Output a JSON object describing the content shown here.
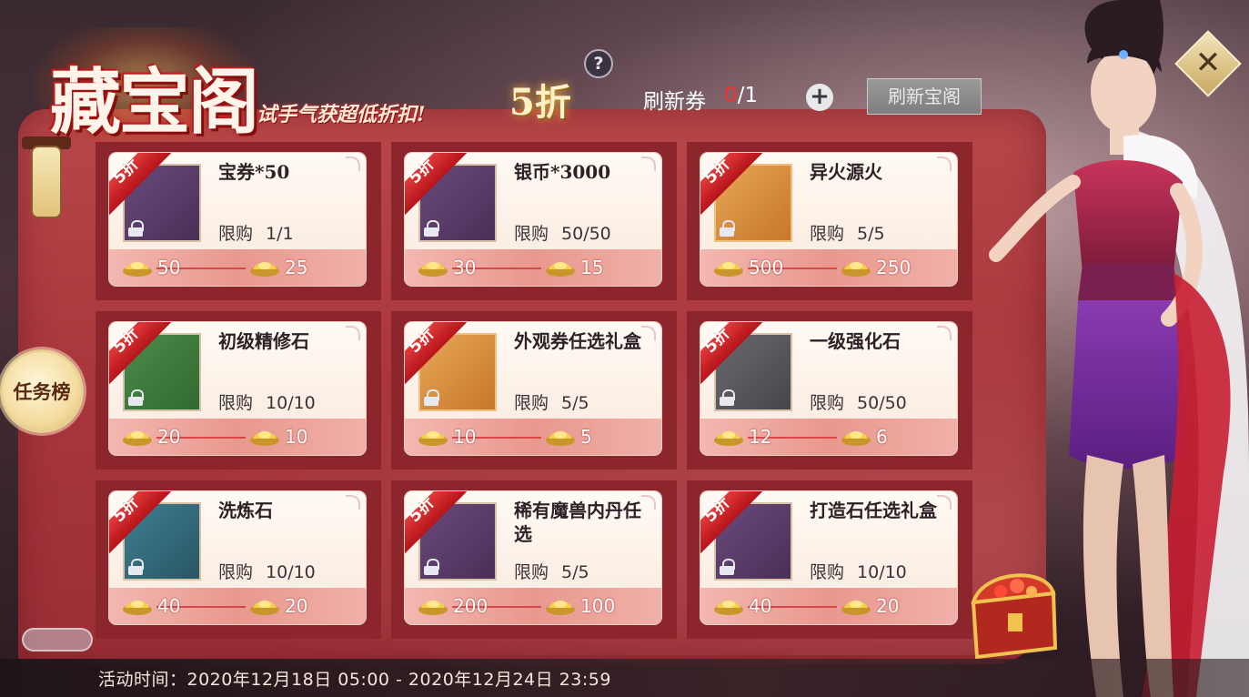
{
  "header": {
    "title": "藏宝阁",
    "subtitle": "试手气获超低折扣!",
    "discount": "5折",
    "help": "?",
    "refresh_label": "刷新券",
    "refresh_current": "0",
    "refresh_total": "/1",
    "plus": "+",
    "refresh_shop_button": "刷新宝阁",
    "close": "✕"
  },
  "side": {
    "task_button": "任务榜"
  },
  "footer": {
    "event_time": "活动时间：2020年12月18日 05:00 - 2020年12月24日 23:59"
  },
  "colors": {
    "panel": "#a8363c",
    "ribbon": "#d42a2a",
    "price_bar": "#e9988e",
    "refresh_current": "#ff2a2a"
  },
  "items": [
    {
      "name": "宝券*50",
      "ribbon": "5折",
      "limit_label": "限购",
      "limit": "1/1",
      "old_price": "50",
      "new_price": "25",
      "icon": "treasure-coupon-icon",
      "tone": "purple"
    },
    {
      "name": "银币*3000",
      "ribbon": "5折",
      "limit_label": "限购",
      "limit": "50/50",
      "old_price": "30",
      "new_price": "15",
      "icon": "silver-coin-icon",
      "tone": "purple"
    },
    {
      "name": "异火源火",
      "ribbon": "5折",
      "limit_label": "限购",
      "limit": "5/5",
      "old_price": "500",
      "new_price": "250",
      "icon": "flame-icon",
      "tone": "orange"
    },
    {
      "name": "初级精修石",
      "ribbon": "5折",
      "limit_label": "限购",
      "limit": "10/10",
      "old_price": "20",
      "new_price": "10",
      "icon": "crystal-icon",
      "tone": "green"
    },
    {
      "name": "外观券任选礼盒",
      "ribbon": "5折",
      "limit_label": "限购",
      "limit": "5/5",
      "old_price": "10",
      "new_price": "5",
      "icon": "gift-box-icon",
      "tone": "orange"
    },
    {
      "name": "一级强化石",
      "ribbon": "5折",
      "limit_label": "限购",
      "limit": "50/50",
      "old_price": "12",
      "new_price": "6",
      "icon": "ore-stone-icon",
      "tone": "grey"
    },
    {
      "name": "洗炼石",
      "ribbon": "5折",
      "limit_label": "限购",
      "limit": "10/10",
      "old_price": "40",
      "new_price": "20",
      "icon": "blue-gem-icon",
      "tone": "blue"
    },
    {
      "name": "稀有魔兽内丹任选",
      "ribbon": "5折",
      "limit_label": "限购",
      "limit": "5/5",
      "old_price": "200",
      "new_price": "100",
      "icon": "gift-package-icon",
      "tone": "purple"
    },
    {
      "name": "打造石任选礼盒",
      "ribbon": "5折",
      "limit_label": "限购",
      "limit": "10/10",
      "old_price": "40",
      "new_price": "20",
      "icon": "chest-icon",
      "tone": "purple"
    }
  ]
}
